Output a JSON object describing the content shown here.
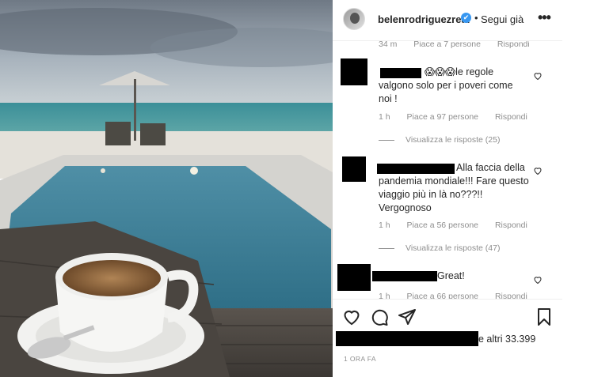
{
  "post": {
    "username": "belenrodriguezreal",
    "verified_badge": "✔",
    "separator": "•",
    "follow_label": "Segui già",
    "more_label": "•••"
  },
  "comments": {
    "top_partial_meta": {
      "time": "34 m",
      "likes": "Piace a 7 persone",
      "reply": "Rispondi"
    },
    "items": [
      {
        "text": "😱😱😱le regole valgono solo per i poveri come noi !",
        "time": "1 h",
        "likes": "Piace a 97 persone",
        "reply": "Rispondi",
        "view_replies": "Visualizza le risposte (25)"
      },
      {
        "text": "Alla faccia della pandemia mondiale!!! Fare questo viaggio più in là no???!! Vergognoso",
        "time": "1 h",
        "likes": "Piace a 56 persone",
        "reply": "Rispondi",
        "view_replies": "Visualizza le risposte (47)"
      },
      {
        "text": "Great!",
        "time": "1 h",
        "likes": "Piace a 66 persone",
        "reply": "Rispondi"
      }
    ]
  },
  "footer": {
    "likes_suffix": "e altri 33.399",
    "timestamp": "1 ORA FA"
  },
  "icons": [
    "heart-icon",
    "comment-icon",
    "share-icon",
    "bookmark-icon"
  ]
}
